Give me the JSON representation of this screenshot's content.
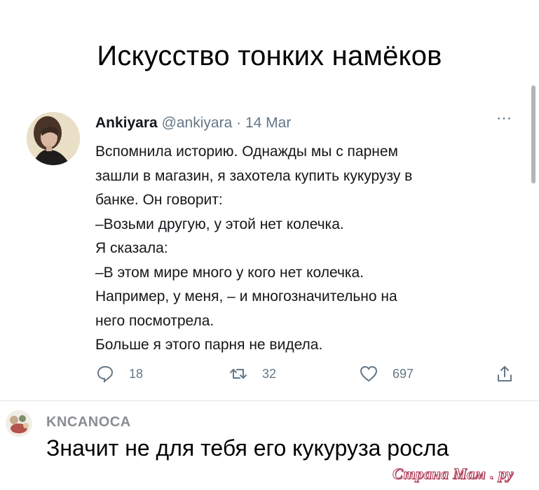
{
  "headline": "Искусство тонких намёков",
  "tweet": {
    "author_name": "Ankiyara",
    "handle": "@ankiyara",
    "separator": "·",
    "date": "14 Mar",
    "more_icon": "more-dots-icon",
    "lines": [
      "Вспомнила историю. Однажды мы с парнем",
      "зашли в магазин, я захотела купить кукурузу в",
      "банке. Он говорит:",
      "–Возьми другую, у этой нет колечка.",
      "Я сказала:",
      "–В этом мире много у кого нет колечка.",
      "Например, у меня, – и многозначительно на",
      "него посмотрела.",
      "Больше я этого парня не видела."
    ],
    "actions": {
      "replies": "18",
      "retweets": "32",
      "likes": "697"
    }
  },
  "comment": {
    "author": "KNCANOCA",
    "text": "Значит не для тебя его кукуруза росла"
  },
  "watermark": "Страна Мам . ру",
  "colors": {
    "secondary_text": "#657786",
    "primary_text": "#14171a",
    "watermark_outline": "#b0405a"
  }
}
